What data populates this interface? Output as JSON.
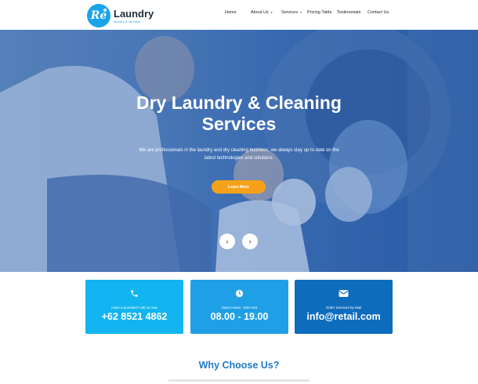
{
  "logo": {
    "mark": "Re",
    "title": "Laundry",
    "subtitle": "laundry & services"
  },
  "nav": {
    "items": [
      {
        "label": "Home",
        "dropdown": false
      },
      {
        "label": "About Us",
        "dropdown": true
      },
      {
        "label": "Services",
        "dropdown": true
      },
      {
        "label": "Pricing Table",
        "dropdown": false
      },
      {
        "label": "Testimonials",
        "dropdown": false
      },
      {
        "label": "Contact Us",
        "dropdown": false
      }
    ]
  },
  "hero": {
    "title_line1": "Dry Laundry & Cleaning",
    "title_line2": "Services",
    "subtitle": "We are professionals in the laundry and dry cleaning business, we always stay up to date on the latest technologies and solutions.",
    "button_label": "Learn More",
    "prev_icon": "chevron-left-icon",
    "next_icon": "chevron-right-icon"
  },
  "info_boxes": [
    {
      "icon": "phone-icon",
      "label": "Have a question? call us now",
      "value": "+62 8521 4862",
      "color": "#12b5f0"
    },
    {
      "icon": "clock-icon",
      "label": "Open Hours : Mon-Sat",
      "value": "08.00 - 19.00",
      "color": "#1fa0e6"
    },
    {
      "icon": "envelope-icon",
      "label": "Order Services by Mail",
      "value": "info@retail.com",
      "color": "#0e6cbd"
    }
  ],
  "why": {
    "title": "Why Choose Us?"
  },
  "colors": {
    "accent": "#1aa3e8",
    "button": "#f5a21a",
    "heading": "#1f7ac6"
  }
}
